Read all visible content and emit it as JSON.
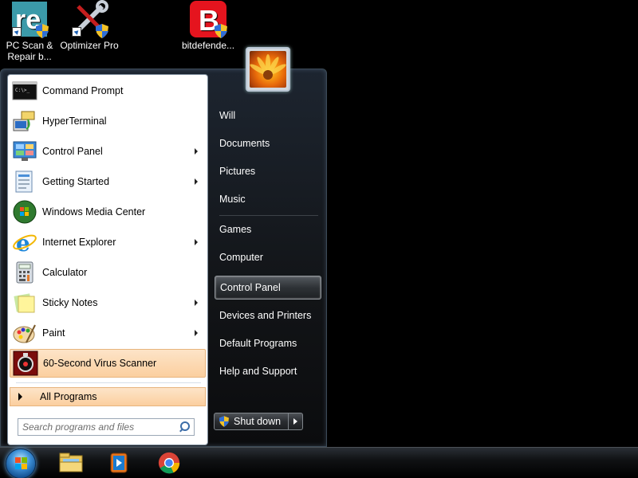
{
  "desktop": {
    "icons": [
      {
        "name": "pc-scan-repair",
        "label": "PC Scan & Repair b..."
      },
      {
        "name": "optimizer-pro",
        "label": "Optimizer Pro"
      },
      {
        "name": "bitdefender",
        "label": "bitdefende..."
      }
    ]
  },
  "start_menu": {
    "programs": [
      {
        "label": "Command Prompt",
        "icon": "cmd-icon",
        "has_submenu": false
      },
      {
        "label": "HyperTerminal",
        "icon": "hyperterminal-icon",
        "has_submenu": false
      },
      {
        "label": "Control Panel",
        "icon": "control-panel-icon",
        "has_submenu": true
      },
      {
        "label": "Getting Started",
        "icon": "getting-started-icon",
        "has_submenu": true
      },
      {
        "label": "Windows Media Center",
        "icon": "media-center-icon",
        "has_submenu": false
      },
      {
        "label": "Internet Explorer",
        "icon": "ie-icon",
        "has_submenu": true
      },
      {
        "label": "Calculator",
        "icon": "calculator-icon",
        "has_submenu": false
      },
      {
        "label": "Sticky Notes",
        "icon": "sticky-notes-icon",
        "has_submenu": true
      },
      {
        "label": "Paint",
        "icon": "paint-icon",
        "has_submenu": true
      },
      {
        "label": "60-Second Virus Scanner",
        "icon": "virus-scanner-icon",
        "has_submenu": false
      }
    ],
    "all_programs_label": "All Programs",
    "search_placeholder": "Search programs and files",
    "right_pane": {
      "user_name": "Will",
      "items": [
        {
          "label": "Will"
        },
        {
          "label": "Documents"
        },
        {
          "label": "Pictures"
        },
        {
          "label": "Music"
        },
        {
          "label": "Games"
        },
        {
          "label": "Computer"
        },
        {
          "label": "Control Panel"
        },
        {
          "label": "Devices and Printers"
        },
        {
          "label": "Default Programs"
        },
        {
          "label": "Help and Support"
        }
      ],
      "shutdown_label": "Shut down"
    }
  },
  "taskbar": {
    "pinned": [
      {
        "name": "windows-explorer"
      },
      {
        "name": "media-player"
      },
      {
        "name": "chrome"
      }
    ]
  },
  "colors": {
    "highlight_orange": "#fbcf9f",
    "start_menu_dark": "#121417"
  }
}
